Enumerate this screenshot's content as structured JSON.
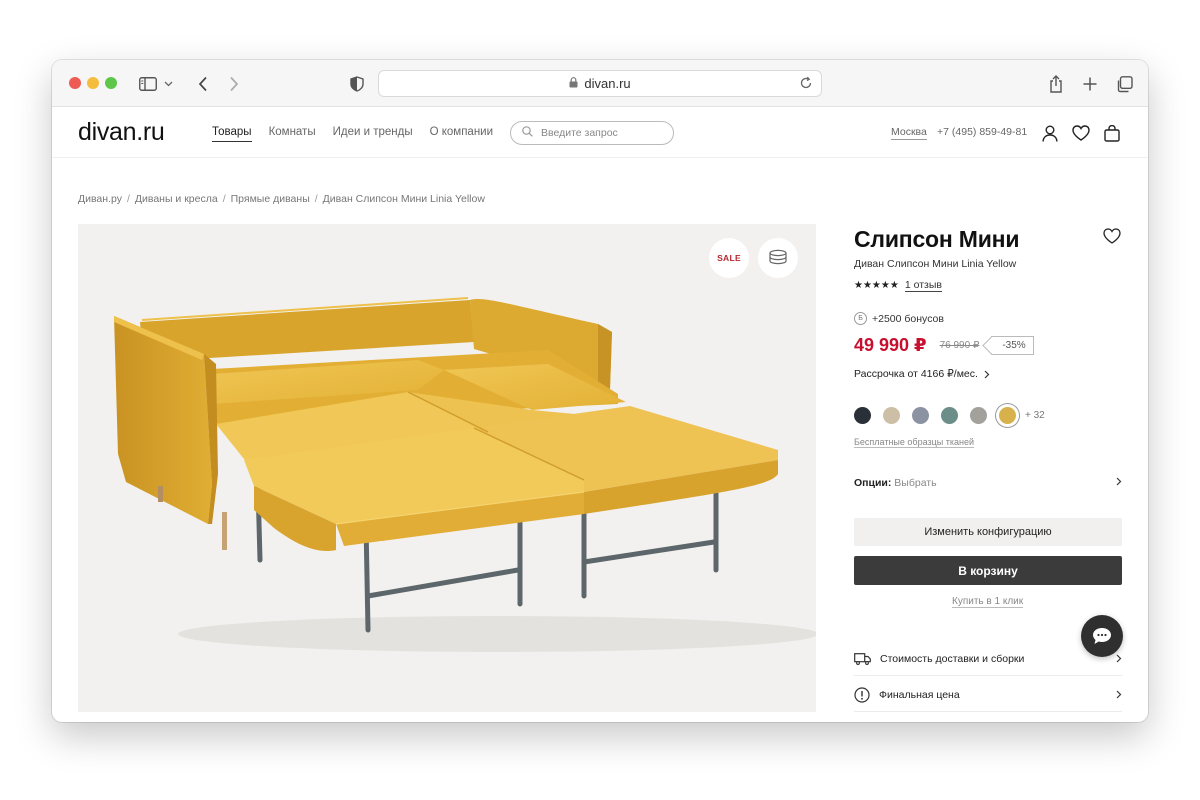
{
  "browser": {
    "url": "divan.ru",
    "icons": [
      "sidebar-icon",
      "chevron-down-icon",
      "back-icon",
      "forward-icon",
      "shield-icon",
      "lock-icon",
      "reload-icon",
      "share-icon",
      "plus-icon",
      "tabs-icon"
    ]
  },
  "header": {
    "logo": "divan.ru",
    "nav": [
      "Товары",
      "Комнаты",
      "Идеи и тренды",
      "О компании"
    ],
    "search_placeholder": "Введите запрос",
    "city": "Москва",
    "phone": "+7 (495) 859-49-81"
  },
  "breadcrumb": [
    "Диван.ру",
    "Диваны и кресла",
    "Прямые диваны",
    "Диван Слипсон Мини Linia Yellow"
  ],
  "gallery": {
    "sale_badge": "SALE"
  },
  "product": {
    "title": "Слипсон Мини",
    "subtitle": "Диван Слипсон Мини Linia Yellow",
    "stars": "★★★★★",
    "reviews": "1 отзыв",
    "bonus_icon": "Б",
    "bonus": "+2500 бонусов",
    "price": "49 990 ₽",
    "old_price": "76 990 ₽",
    "discount": "-35%",
    "installment": "Рассрочка от 4166 ₽/мес.",
    "swatch_colors": [
      "#2a3038",
      "#cdbfa6",
      "#8b93a3",
      "#6c8e89",
      "#a3a19c",
      "#d7b24c"
    ],
    "swatches_more": "+ 32",
    "samples_link": "Бесплатные образцы тканей",
    "options_label": "Опции:",
    "options_value": "Выбрать",
    "config_button": "Изменить конфигурацию",
    "cart_button": "В корзину",
    "one_click": "Купить в 1 клик",
    "delivery": "Стоимость доставки и сборки",
    "final_price": "Финальная цена"
  },
  "colors": {
    "accent_price": "#c8102e",
    "sale": "#b8262e",
    "cart_button": "#3b3b3b",
    "sofa": "#e3b135"
  }
}
